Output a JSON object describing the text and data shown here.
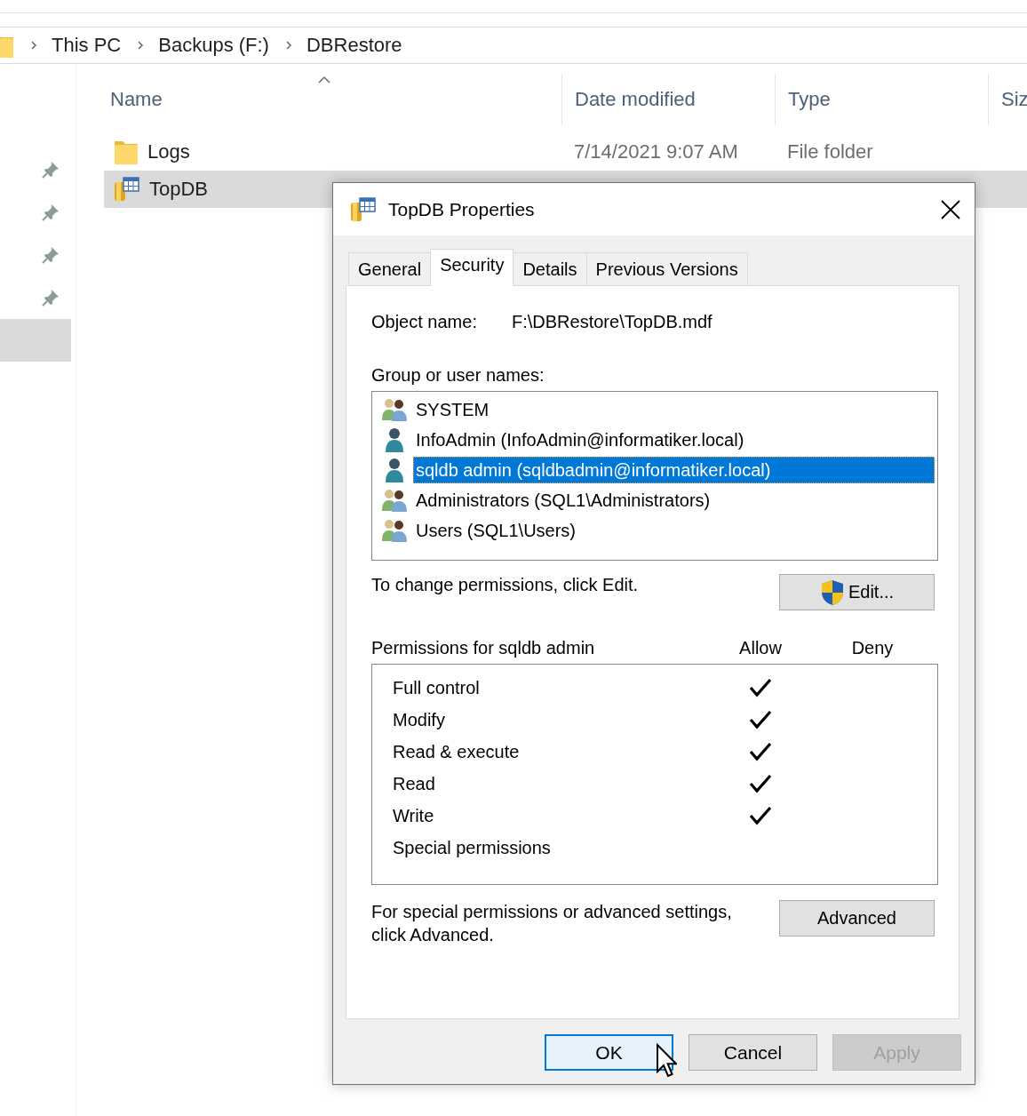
{
  "breadcrumb": [
    "This PC",
    "Backups (F:)",
    "DBRestore"
  ],
  "sidebar": {
    "items": [
      {
        "pinned": true,
        "selected": false
      },
      {
        "pinned": true,
        "selected": false
      },
      {
        "pinned": true,
        "selected": false
      },
      {
        "pinned": true,
        "selected": false
      },
      {
        "pinned": false,
        "selected": true
      }
    ]
  },
  "file_list": {
    "columns": [
      {
        "label": "Name",
        "sorted": true
      },
      {
        "label": "Date modified",
        "sorted": false
      },
      {
        "label": "Type",
        "sorted": false
      },
      {
        "label": "Siz",
        "sorted": false
      }
    ],
    "rows": [
      {
        "kind": "folder",
        "name": "Logs",
        "date_modified": "7/14/2021 9:07 AM",
        "type": "File folder",
        "selected": false
      },
      {
        "kind": "database",
        "name": "TopDB",
        "selected": true
      }
    ]
  },
  "dialog": {
    "title": "TopDB Properties",
    "tabs": [
      {
        "label": "General",
        "selected": false
      },
      {
        "label": "Security",
        "selected": true
      },
      {
        "label": "Details",
        "selected": false
      },
      {
        "label": "Previous Versions",
        "selected": false
      }
    ],
    "object_name_label": "Object name:",
    "object_name": "F:\\DBRestore\\TopDB.mdf",
    "users_label": "Group or user names:",
    "users": [
      {
        "kind": "group",
        "name": "SYSTEM",
        "selected": false
      },
      {
        "kind": "user",
        "name": "InfoAdmin (InfoAdmin@informatiker.local)",
        "selected": false
      },
      {
        "kind": "user",
        "name": "sqldb admin (sqldbadmin@informatiker.local)",
        "selected": true
      },
      {
        "kind": "group",
        "name": "Administrators (SQL1\\Administrators)",
        "selected": false
      },
      {
        "kind": "group",
        "name": "Users (SQL1\\Users)",
        "selected": false
      }
    ],
    "change_hint": "To change permissions, click Edit.",
    "edit_button": "Edit...",
    "permissions_label": "Permissions for sqldb admin",
    "allow_label": "Allow",
    "deny_label": "Deny",
    "permissions": [
      {
        "name": "Full control",
        "allow": true,
        "deny": false
      },
      {
        "name": "Modify",
        "allow": true,
        "deny": false
      },
      {
        "name": "Read & execute",
        "allow": true,
        "deny": false
      },
      {
        "name": "Read",
        "allow": true,
        "deny": false
      },
      {
        "name": "Write",
        "allow": true,
        "deny": false
      },
      {
        "name": "Special permissions",
        "allow": false,
        "deny": false
      }
    ],
    "advanced_hint": "For special permissions or advanced settings, click Advanced.",
    "advanced_button": "Advanced",
    "buttons": [
      {
        "label": "OK",
        "default": true,
        "disabled": false
      },
      {
        "label": "Cancel",
        "default": false,
        "disabled": false
      },
      {
        "label": "Apply",
        "default": false,
        "disabled": true
      }
    ]
  }
}
